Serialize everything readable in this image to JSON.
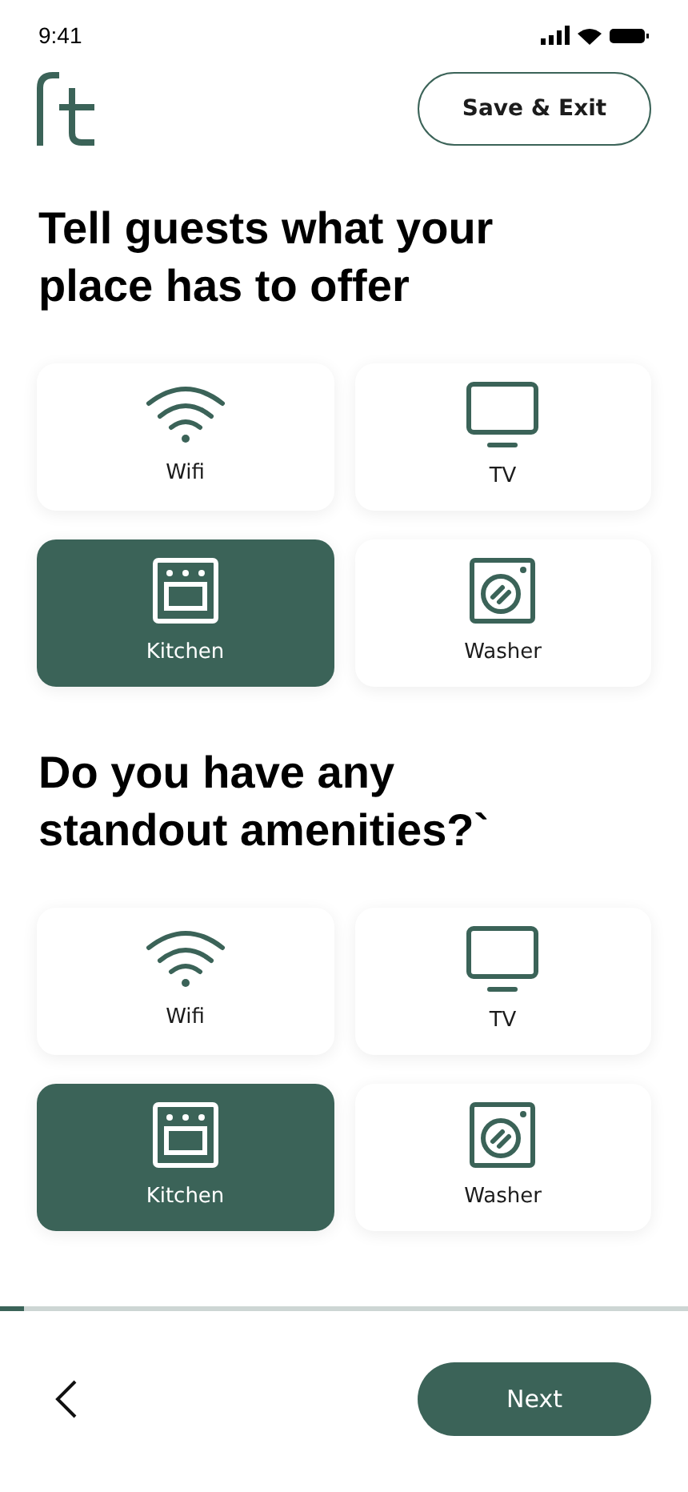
{
  "status_bar": {
    "time": "9:41"
  },
  "header": {
    "save_button": "Save & Exit"
  },
  "sections": [
    {
      "heading": "Tell guests what your place has to offer",
      "options": [
        {
          "kind": "wifi",
          "label": "Wifi",
          "selected": false
        },
        {
          "kind": "tv",
          "label": "TV",
          "selected": false
        },
        {
          "kind": "oven",
          "label": "Kitchen",
          "selected": true
        },
        {
          "kind": "washer",
          "label": "Washer",
          "selected": false
        }
      ]
    },
    {
      "heading": "Do you have any standout amenities?`",
      "options": [
        {
          "kind": "wifi",
          "label": "Wifi",
          "selected": false
        },
        {
          "kind": "tv",
          "label": "TV",
          "selected": false
        },
        {
          "kind": "oven",
          "label": "Kitchen",
          "selected": true
        },
        {
          "kind": "washer",
          "label": "Washer",
          "selected": false
        }
      ]
    }
  ],
  "progress": {
    "level": 0.035
  },
  "footer": {
    "next_button": "Next"
  }
}
